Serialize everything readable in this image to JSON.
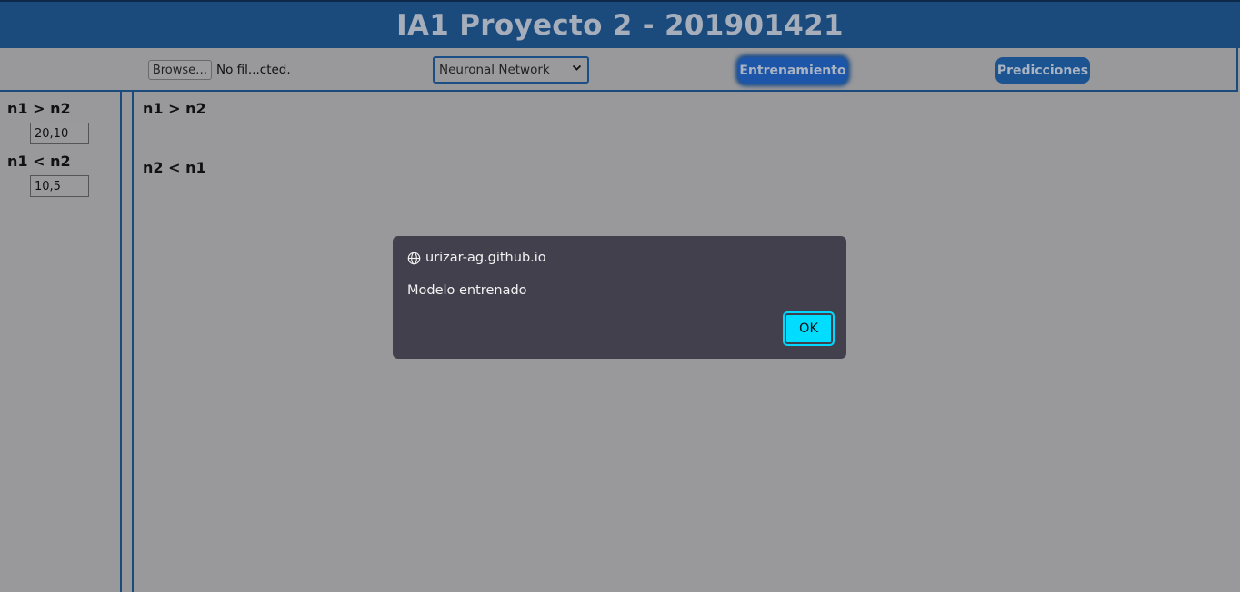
{
  "header": {
    "title": "IA1 Proyecto 2 - 201901421"
  },
  "toolbar": {
    "file_button": "Browse…",
    "file_status": "No fil...cted.",
    "model_select_value": "Neuronal Network",
    "train_button": "Entrenamiento",
    "predict_button": "Predicciones"
  },
  "sidebar": {
    "items": [
      {
        "label": "n1 > n2",
        "value": "20,10"
      },
      {
        "label": "n1 < n2",
        "value": "10,5"
      }
    ]
  },
  "main": {
    "results": [
      {
        "label": "n1 > n2"
      },
      {
        "label": "n2 < n1"
      }
    ]
  },
  "dialog": {
    "origin": "urizar-ag.github.io",
    "message": "Modelo entrenado",
    "ok_label": "OK",
    "icon": "globe-icon"
  },
  "colors": {
    "header_bg": "#1b4a7d",
    "overlay_bg": "#99999b",
    "dialog_bg": "#42404d",
    "ok_accent": "#00ddff"
  }
}
